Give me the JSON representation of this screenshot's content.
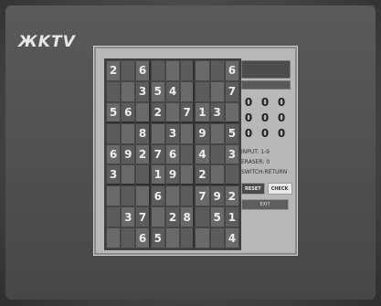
{
  "logo": {
    "text": "ЖKTV"
  },
  "sudoku": {
    "rows": [
      [
        "2",
        "",
        "6",
        "",
        "",
        "",
        "",
        "",
        "6"
      ],
      [
        "",
        "",
        "3",
        "5",
        "4",
        "",
        "",
        "",
        "7"
      ],
      [
        "5",
        "6",
        "",
        "2",
        "",
        "7",
        "1",
        "3",
        ""
      ],
      [
        "",
        "",
        "8",
        "",
        "3",
        "",
        "9",
        "",
        "5"
      ],
      [
        "6",
        "9",
        "2",
        "7",
        "6",
        "",
        "4",
        "",
        "3"
      ],
      [
        "3",
        "",
        "",
        "1",
        "9",
        "",
        "2",
        "",
        ""
      ],
      [
        "",
        "",
        "",
        "6",
        "",
        "",
        "7",
        "9",
        "2"
      ],
      [
        "",
        "3",
        "7",
        "",
        "2",
        "8",
        "",
        "5",
        "1"
      ],
      [
        "",
        "",
        "6",
        "5",
        "",
        "",
        "",
        "",
        "4"
      ]
    ]
  },
  "sidebar": {
    "timer_text": "",
    "keypad": [
      "0",
      "0",
      "0",
      "0",
      "0",
      "0",
      "0",
      "0",
      "0"
    ],
    "info_lines": [
      "INPUT: 1-9",
      "ERASER: 0",
      "SWITCH:RETURN"
    ],
    "buttons": {
      "reset": "RESET",
      "check": "CHECK",
      "exit": "EXIT"
    }
  }
}
